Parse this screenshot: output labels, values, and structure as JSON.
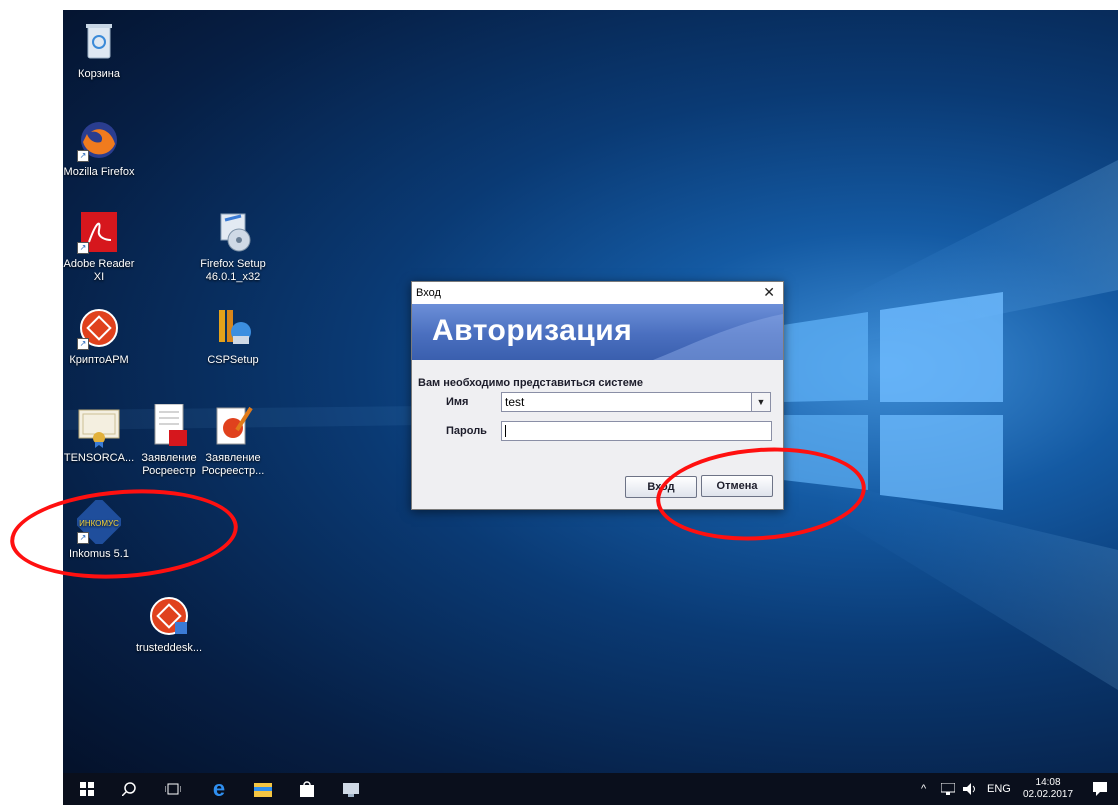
{
  "desktop": {
    "icons": [
      {
        "label": "Корзина",
        "icon": "recycle-bin-icon"
      },
      {
        "label": "Mozilla Firefox",
        "icon": "firefox-icon"
      },
      {
        "label": "Adobe Reader XI",
        "icon": "adobe-reader-icon"
      },
      {
        "label": "Firefox Setup 46.0.1_x32",
        "icon": "installer-icon"
      },
      {
        "label": "КриптоАРМ",
        "icon": "cryptoarm-icon"
      },
      {
        "label": "CSPSetup",
        "icon": "csp-setup-icon"
      },
      {
        "label": "TENSORCA...",
        "icon": "certificate-icon"
      },
      {
        "label": "Заявление Росреестр",
        "icon": "pdf-document-icon"
      },
      {
        "label": "Заявление Росреестр...",
        "icon": "signed-document-icon"
      },
      {
        "label": "Inkomus 5.1",
        "icon": "inkomus-icon"
      },
      {
        "label": "trusteddesk...",
        "icon": "trusteddesk-icon"
      }
    ]
  },
  "dialog": {
    "title": "Вход",
    "close_glyph": "✕",
    "banner": "Авторизация",
    "intro": "Вам необходимо представиться системе",
    "name_label": "Имя",
    "name_value": "test",
    "password_label": "Пароль",
    "password_value": "",
    "login_button": "Вход",
    "cancel_button": "Отмена"
  },
  "taskbar": {
    "language": "ENG",
    "time": "14:08",
    "date": "02.02.2017",
    "items": [
      "start-icon",
      "search-icon",
      "task-view-icon",
      "edge-icon",
      "file-explorer-icon",
      "store-icon",
      "app-icon"
    ]
  },
  "annotations": {
    "color": "#ff1010"
  }
}
